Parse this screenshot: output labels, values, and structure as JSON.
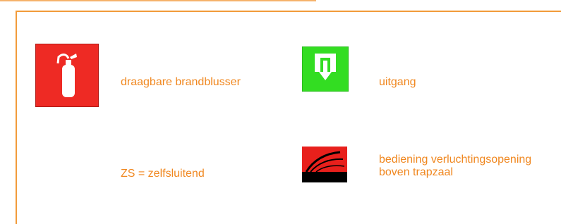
{
  "legend": {
    "items": [
      {
        "icon": "fire-extinguisher-icon",
        "label": "draagbare brandblusser"
      },
      {
        "icon": "exit-icon",
        "label": "uitgang"
      },
      {
        "icon": "",
        "label": "ZS = zelfsluitend"
      },
      {
        "icon": "smoke-vent-control-icon",
        "label_lines": [
          "bediening verluchtingsopening",
          "boven trapzaal"
        ]
      }
    ]
  },
  "colors": {
    "border": "#f29b3a",
    "text": "#f0871f",
    "extinguisher_bg": "#ee2a24",
    "exit_bg": "#33dd22",
    "vent_bg": "#e8201c"
  }
}
